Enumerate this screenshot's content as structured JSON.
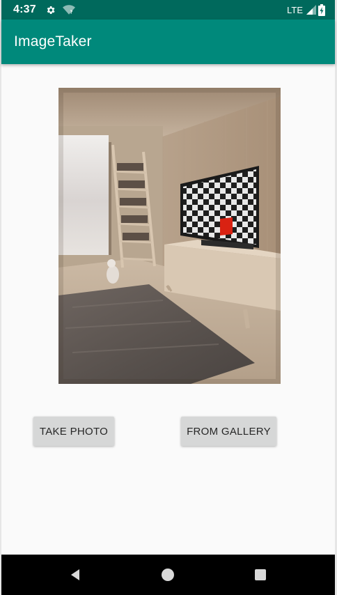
{
  "status_bar": {
    "time": "4:37",
    "network": "LTE",
    "background": "#00695c",
    "icons": [
      "gear-icon",
      "wifi-question-icon",
      "signal-icon",
      "battery-charging-icon"
    ]
  },
  "app_bar": {
    "title": "ImageTaker",
    "background": "#00897b"
  },
  "image": {
    "description_icon": "room-photo-with-tv-checkerboard"
  },
  "buttons": {
    "take_photo": "TAKE PHOTO",
    "from_gallery": "FROM GALLERY"
  },
  "nav_bar": {
    "icons": [
      "back-icon",
      "home-icon",
      "recents-icon"
    ]
  }
}
